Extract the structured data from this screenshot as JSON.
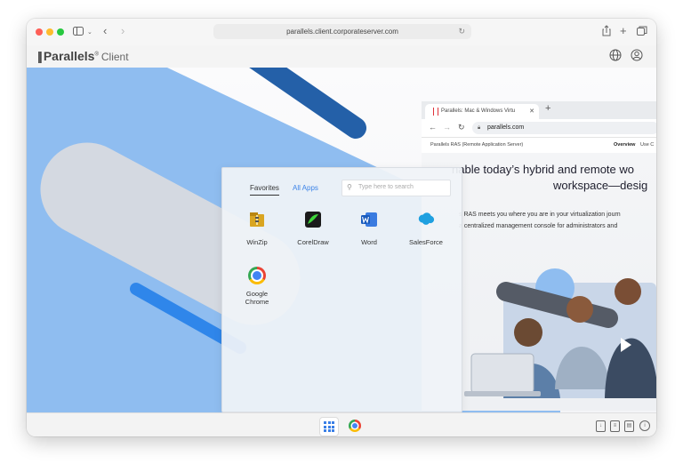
{
  "safari": {
    "url": "parallels.client.corporateserver.com"
  },
  "appbar": {
    "brand": "Parallels",
    "brand_suffix": "Client"
  },
  "launcher": {
    "tabs": [
      {
        "label": "Favorites",
        "active": true
      },
      {
        "label": "All Apps",
        "active": false
      }
    ],
    "search_placeholder": "Type here to search",
    "apps": [
      {
        "name": "WinZip",
        "icon": "winzip-icon"
      },
      {
        "name": "CorelDraw",
        "icon": "coreldraw-icon"
      },
      {
        "name": "Word",
        "icon": "word-icon"
      },
      {
        "name": "SalesForce",
        "icon": "salesforce-icon"
      },
      {
        "name": "Google Chrome",
        "icon": "chrome-icon"
      }
    ]
  },
  "remote_browser": {
    "tab_title": "Parallels: Mac & Windows Virtu",
    "url": "parallels.com",
    "subnav_left": "Parallels RAS (Remote Application Server)",
    "subnav_overview": "Overview",
    "subnav_use": "Use C",
    "hero_line1": "nable today’s hybrid and remote wo",
    "hero_line2": "workspace—desig",
    "body_line1": "s RAS meets you where you are in your virtualization journ",
    "body_line2": "a centralized management console for administrators and"
  },
  "colors": {
    "accent": "#3d84e8",
    "stripe_light": "#8fbdf0",
    "stripe_dark": "#2460a8",
    "stripe_mid": "#2f86ea",
    "capsule_gray": "#d4d9e1"
  }
}
